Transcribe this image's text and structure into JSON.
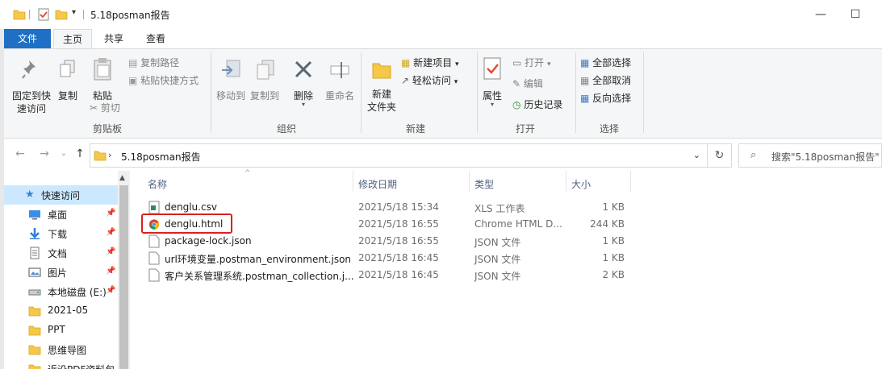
{
  "window": {
    "title": "5.18posman报告",
    "minimize": "—",
    "maximize": "☐"
  },
  "tabs": [
    {
      "label": "文件"
    },
    {
      "label": "主页"
    },
    {
      "label": "共享"
    },
    {
      "label": "查看"
    }
  ],
  "ribbon": {
    "pin": "固定到快\n速访问",
    "copy": "复制",
    "paste": "粘贴",
    "copy_path": "复制路径",
    "paste_shortcut": "粘贴快捷方式",
    "cut": "剪切",
    "clipboard_group": "剪贴板",
    "move_to": "移动到",
    "copy_to": "复制到",
    "delete": "删除",
    "rename": "重命名",
    "organize_group": "组织",
    "new_folder": "新建\n文件夹",
    "new_item": "新建项目",
    "easy_access": "轻松访问",
    "new_group": "新建",
    "properties": "属性",
    "open": "打开",
    "edit": "编辑",
    "history": "历史记录",
    "open_group": "打开",
    "select_all": "全部选择",
    "select_none": "全部取消",
    "invert": "反向选择",
    "select_group": "选择"
  },
  "address": {
    "path": "5.18posman报告",
    "search_placeholder": "搜索\"5.18posman报告\""
  },
  "nav": [
    {
      "label": "快速访问"
    },
    {
      "label": "桌面"
    },
    {
      "label": "下载"
    },
    {
      "label": "文档"
    },
    {
      "label": "图片"
    },
    {
      "label": "本地磁盘 (E:)"
    },
    {
      "label": "2021-05"
    },
    {
      "label": "PPT"
    },
    {
      "label": "思维导图"
    },
    {
      "label": "近沿PDF资料包"
    }
  ],
  "columns": {
    "name": "名称",
    "date": "修改日期",
    "type": "类型",
    "size": "大小"
  },
  "files": [
    {
      "name": "denglu.csv",
      "date": "2021/5/18 15:34",
      "type": "XLS 工作表",
      "size": "1 KB",
      "icon": "csv-file-icon"
    },
    {
      "name": "denglu.html",
      "date": "2021/5/18 16:55",
      "type": "Chrome HTML D...",
      "size": "244 KB",
      "icon": "chrome-html-icon"
    },
    {
      "name": "package-lock.json",
      "date": "2021/5/18 16:55",
      "type": "JSON 文件",
      "size": "1 KB",
      "icon": "file-icon"
    },
    {
      "name": "url环境变量.postman_environment.json",
      "date": "2021/5/18 16:45",
      "type": "JSON 文件",
      "size": "1 KB",
      "icon": "file-icon"
    },
    {
      "name": "客户关系管理系统.postman_collection.j...",
      "date": "2021/5/18 16:45",
      "type": "JSON 文件",
      "size": "2 KB",
      "icon": "file-icon"
    }
  ],
  "colors": {
    "file_tab": "#1f6fc4",
    "selection": "#cce8ff",
    "highlight_box": "#d9211d",
    "folder": "#f5c74a"
  }
}
